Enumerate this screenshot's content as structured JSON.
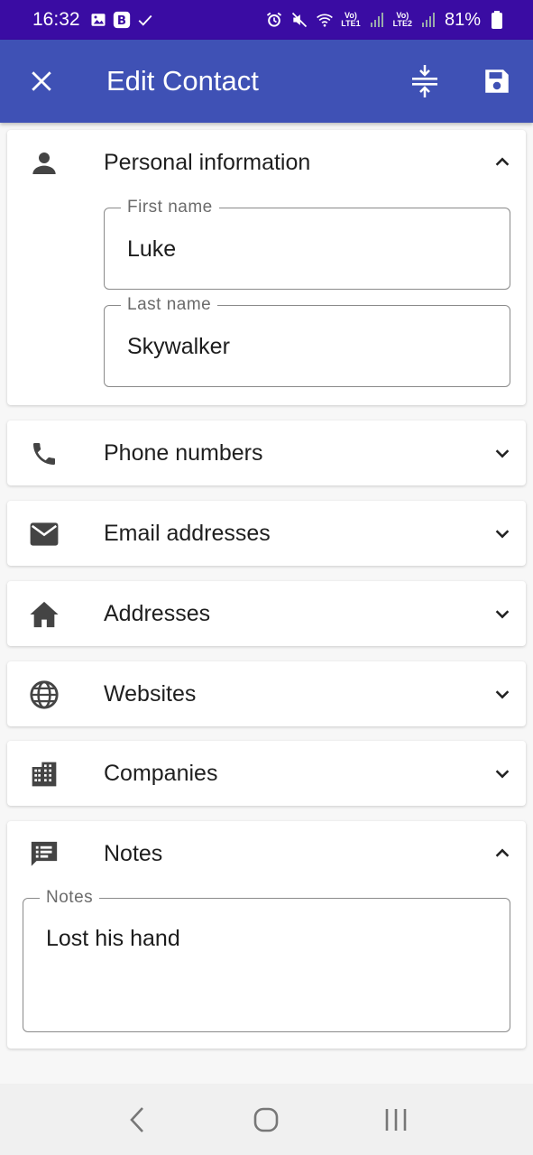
{
  "status": {
    "time": "16:32",
    "battery": "81%",
    "net1": "Vo)\nLTE1",
    "net2": "Vo)\nLTE2"
  },
  "appbar": {
    "title": "Edit Contact",
    "close_icon": "close-icon",
    "collapse_icon": "compress-vertical-icon",
    "save_icon": "save-icon",
    "color": "#3f51b5"
  },
  "sections": {
    "personal": {
      "label": "Personal information",
      "expanded": true
    },
    "phones": {
      "label": "Phone numbers",
      "expanded": false
    },
    "emails": {
      "label": "Email addresses",
      "expanded": false
    },
    "addresses": {
      "label": "Addresses",
      "expanded": false
    },
    "websites": {
      "label": "Websites",
      "expanded": false
    },
    "companies": {
      "label": "Companies",
      "expanded": false
    },
    "notes": {
      "label": "Notes",
      "expanded": true
    }
  },
  "fields": {
    "first_name": {
      "label": "First name",
      "value": "Luke"
    },
    "last_name": {
      "label": "Last name",
      "value": "Skywalker"
    },
    "notes": {
      "label": "Notes",
      "value": "Lost his hand"
    }
  }
}
